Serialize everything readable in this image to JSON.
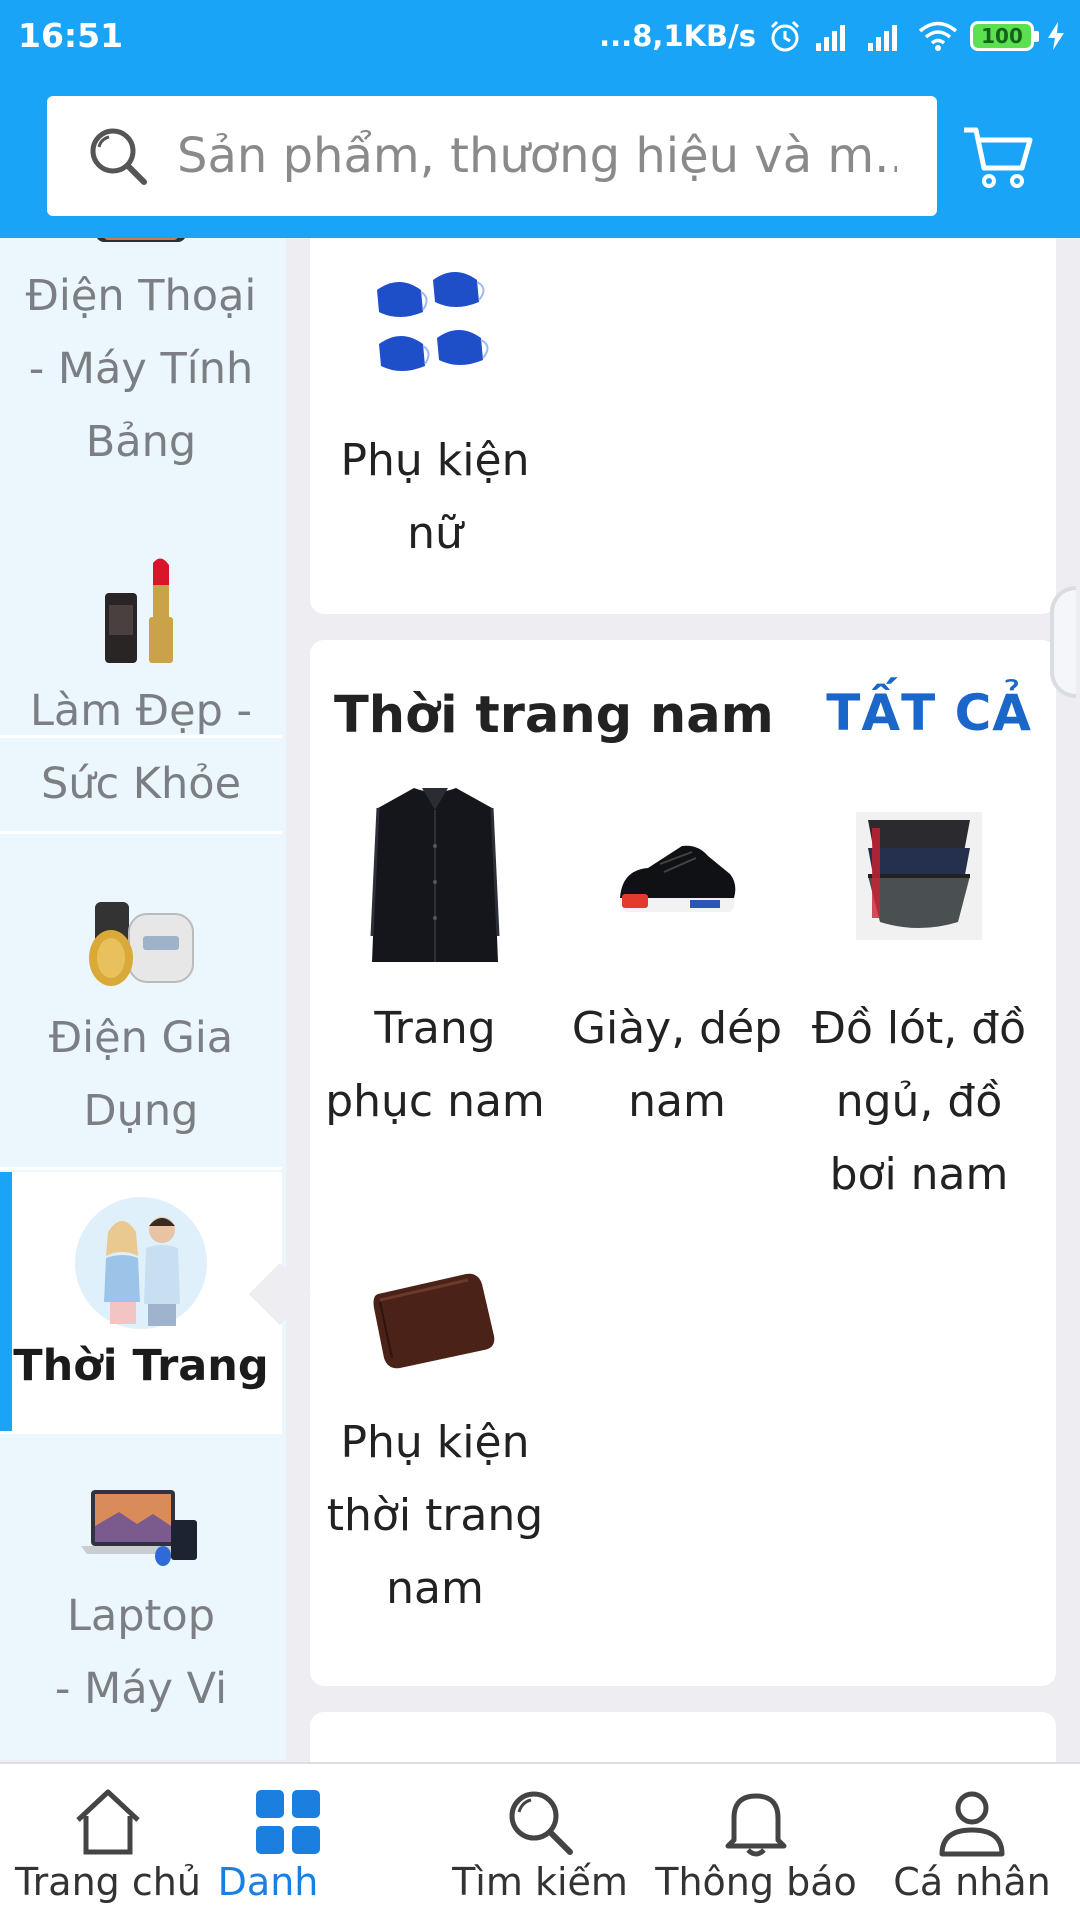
{
  "status_bar": {
    "time": "16:51",
    "network_speed": "...8,1KB/s",
    "battery": "100"
  },
  "search": {
    "placeholder": "Sản phẩm, thương hiệu và m..."
  },
  "sidebar": {
    "items": [
      {
        "label": "Điện Thoại - Máy Tính Bảng",
        "lines": [
          "Điện Thoại",
          "- Máy Tính",
          "Bảng"
        ],
        "icon": "phone-tablet-icon"
      },
      {
        "label": "Làm Đẹp - Sức Khỏe",
        "lines": [
          "Làm Đẹp -",
          "Sức Khỏe"
        ],
        "icon": "lipstick-icon"
      },
      {
        "label": "Điện Gia Dụng",
        "lines": [
          "Điện Gia",
          "Dụng"
        ],
        "icon": "appliance-icon"
      },
      {
        "label": "Thời Trang",
        "lines": [
          "Thời Trang"
        ],
        "icon": "fashion-couple-icon",
        "active": true
      },
      {
        "label": "Laptop - Máy Vi",
        "lines": [
          "Laptop",
          "- Máy Vi"
        ],
        "icon": "laptop-icon"
      }
    ]
  },
  "sections": {
    "women": {
      "items": [
        {
          "lines": [
            "Phụ kiện",
            "nữ"
          ],
          "icon": "face-mask-icon"
        }
      ]
    },
    "men": {
      "title": "Thời trang nam",
      "see_all": "TẤT CẢ",
      "items": [
        {
          "lines": [
            "Trang",
            "phục nam"
          ],
          "icon": "shirt-icon"
        },
        {
          "lines": [
            "Giày, dép",
            "nam"
          ],
          "icon": "sneaker-icon"
        },
        {
          "lines": [
            "Đồ lót, đồ",
            "ngủ, đồ",
            "bơi nam"
          ],
          "icon": "underwear-icon"
        },
        {
          "lines": [
            "Phụ kiện",
            "thời trang",
            "nam"
          ],
          "icon": "wallet-icon"
        }
      ]
    }
  },
  "bottom_nav": {
    "items": [
      {
        "label": "Trang chủ",
        "icon": "home-icon"
      },
      {
        "label": "Danh",
        "icon": "grid-icon",
        "active": true
      },
      {
        "label": "Tìm kiếm",
        "icon": "search-icon"
      },
      {
        "label": "Thông báo",
        "icon": "bell-icon"
      },
      {
        "label": "Cá nhân",
        "icon": "user-icon"
      }
    ]
  },
  "colors": {
    "header_blue": "#1aa4f8",
    "link_blue": "#1b67c9",
    "active_nav": "#1b7fe0",
    "sidebar_bg": "#ecf6fd"
  }
}
